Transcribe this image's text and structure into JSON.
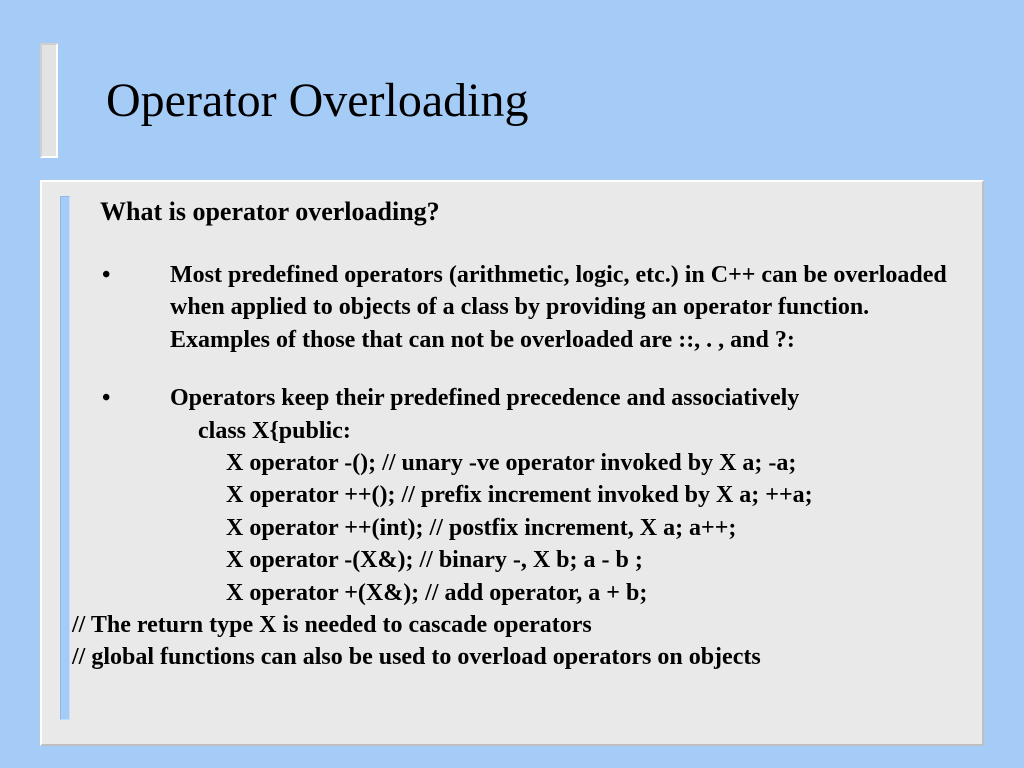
{
  "title": "Operator Overloading",
  "subheading": "What is operator overloading?",
  "bullets": [
    "Most predefined operators (arithmetic, logic, etc.) in C++ can be overloaded when applied to objects of  a class by providing an operator function. Examples of those that can not  be overloaded are ::, . ,  and ?:",
    "Operators keep their predefined precedence and associatively"
  ],
  "code": [
    "class X{public:",
    "X operator -(); // unary -ve operator invoked by X a; -a;",
    "X operator ++(); // prefix increment invoked by X a; ++a;",
    "X operator ++(int); // postfix increment, X a; a++;",
    "X operator -(X&); // binary -, X b; a - b ;",
    "X operator +(X&); // add operator,  a + b;"
  ],
  "comments": [
    "// The return type X is needed to cascade operators",
    "// global functions can also be used to overload operators on objects"
  ],
  "bullet_glyph": "•"
}
